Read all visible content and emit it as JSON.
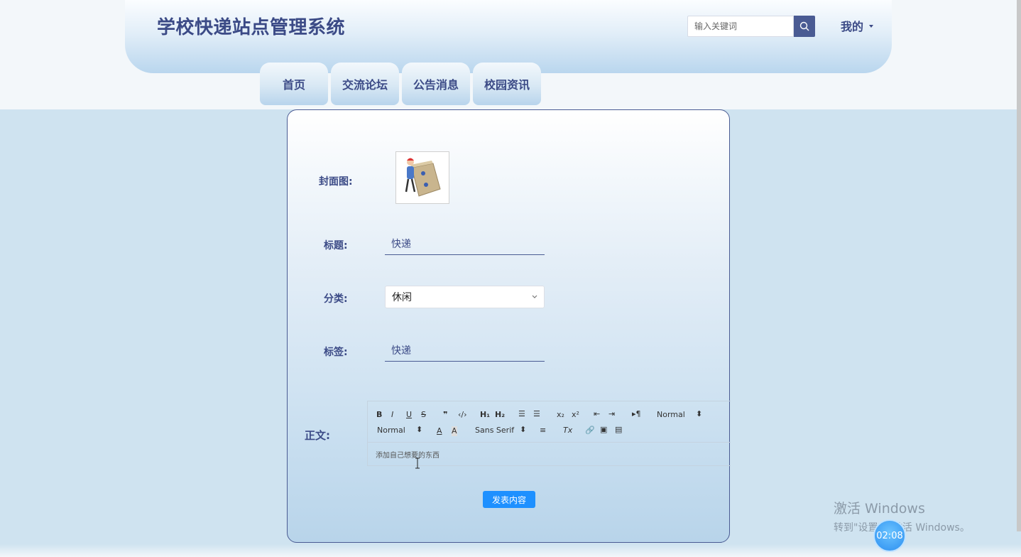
{
  "site": {
    "title": "学校快递站点管理系统"
  },
  "search": {
    "placeholder": "输入关键词"
  },
  "user_menu": {
    "label": "我的"
  },
  "nav": {
    "items": [
      "首页",
      "交流论坛",
      "公告消息",
      "校园资讯"
    ]
  },
  "form": {
    "cover_label": "封面图:",
    "title_label": "标题:",
    "title_value": "快递",
    "category_label": "分类:",
    "category_value": "休闲",
    "tags_label": "标签:",
    "tags_value": "快递",
    "body_label": "正文:",
    "editor": {
      "header_select": "Normal",
      "size_select": "Normal",
      "font_select": "Sans Serif",
      "content": "添加自己想要的东西"
    },
    "submit_label": "发表内容"
  },
  "watermark": {
    "title": "激活 Windows",
    "subtitle": "转到\"设置\"以激活 Windows。"
  },
  "clock": {
    "time": "02:08"
  },
  "colors": {
    "accent": "#4a5b93",
    "button": "#1e90ff",
    "background": "#cfe3f0"
  }
}
